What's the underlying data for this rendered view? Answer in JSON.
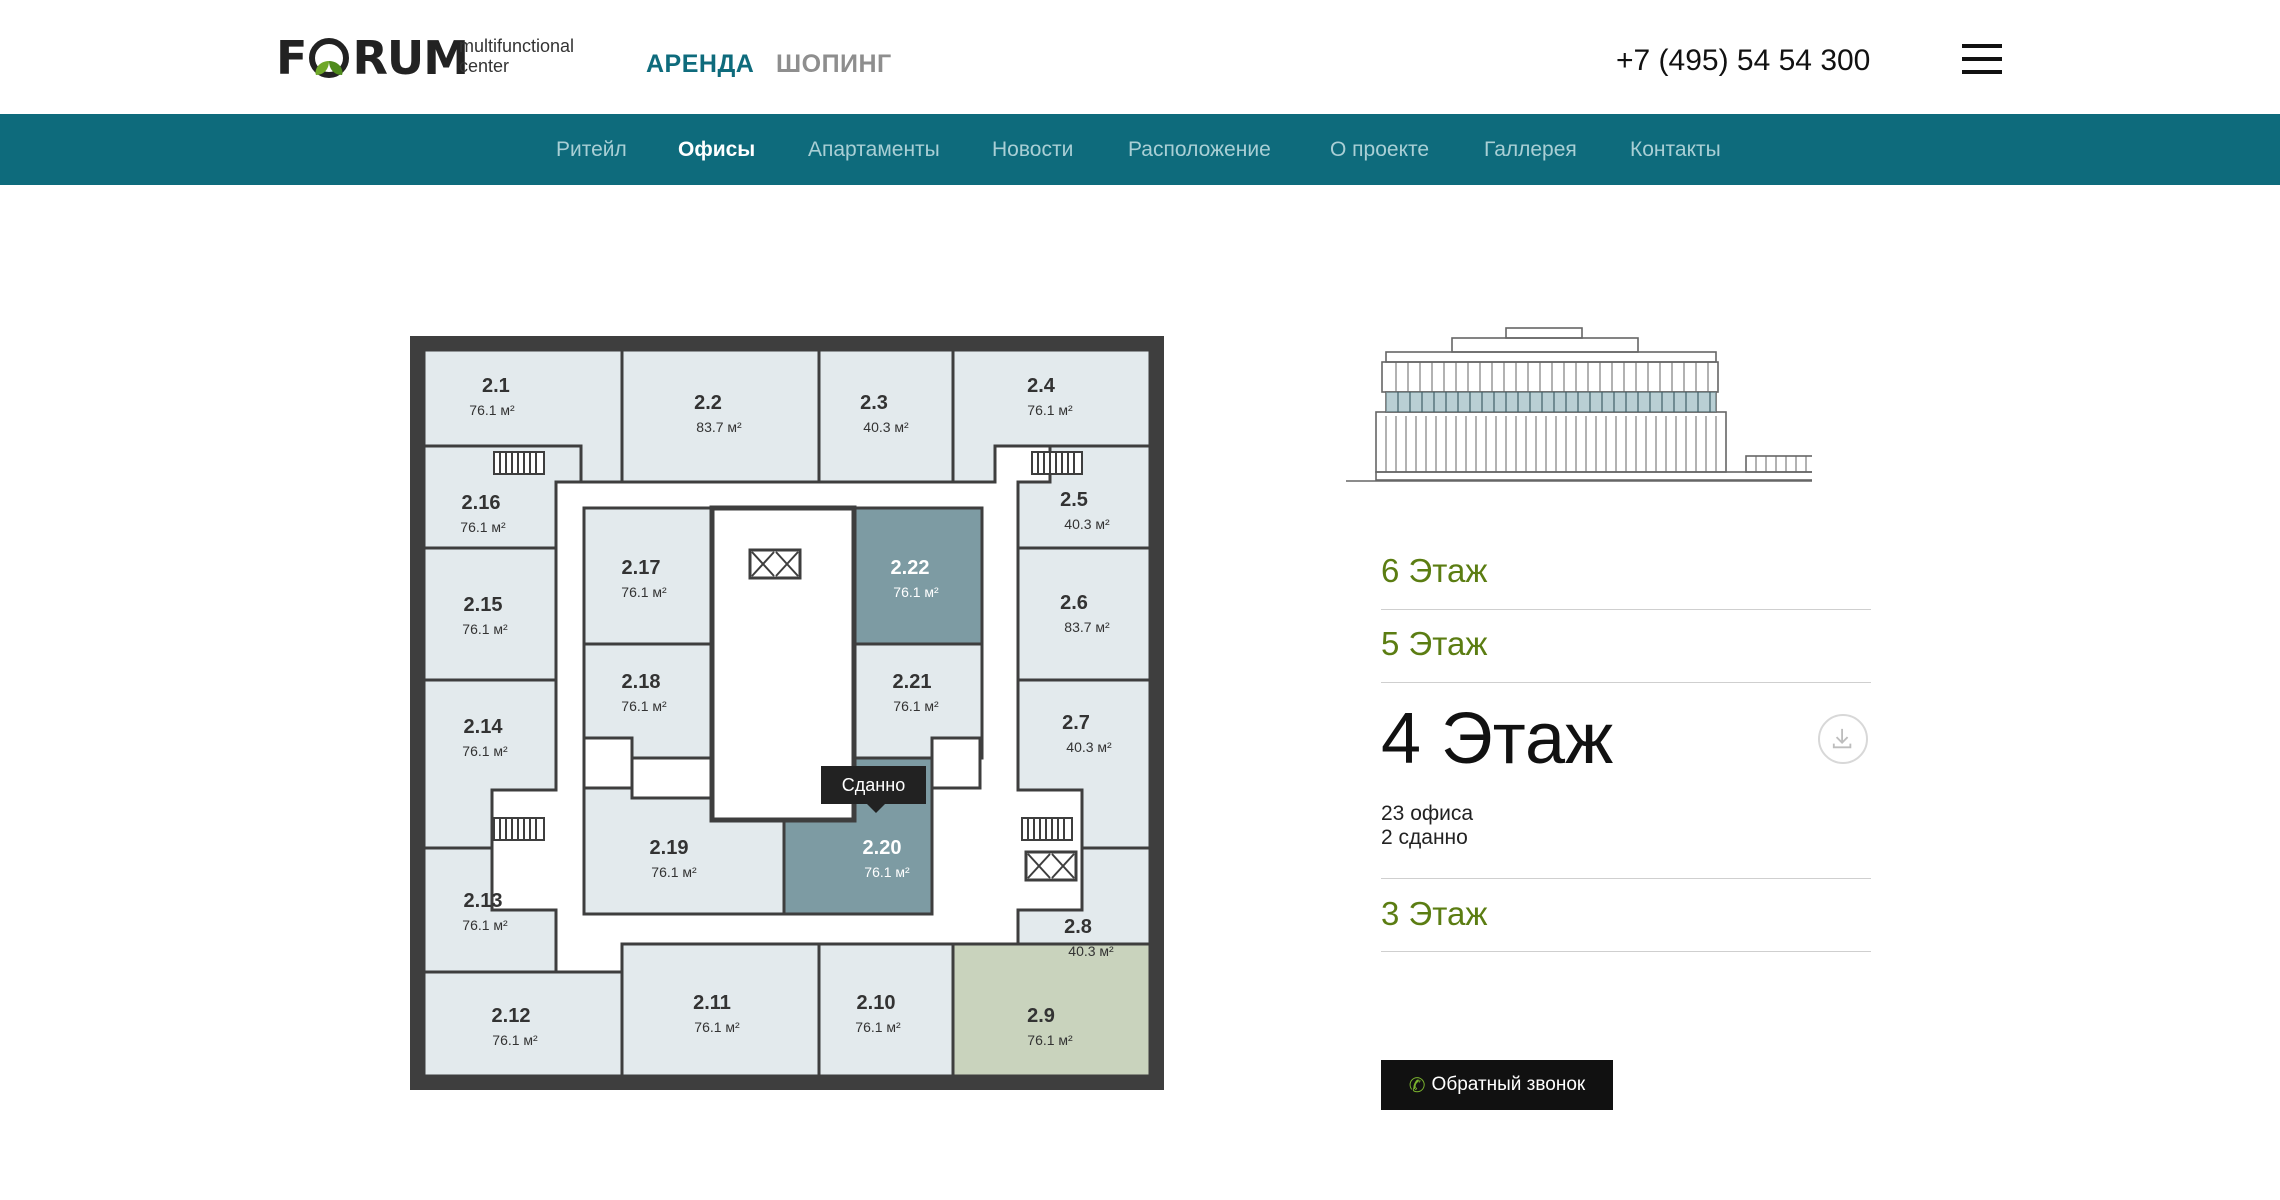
{
  "header": {
    "logo_text_left": "F",
    "logo_text_right": "RUM",
    "logo_sub_1": "multifunctional",
    "logo_sub_2": "center",
    "nav_rent": "АРЕНДА",
    "nav_shopping": "ШОПИНГ",
    "phone": "+7 (495) 54 54 300",
    "menu_icon": "hamburger-menu-icon"
  },
  "navbar": {
    "items": [
      "Ритейл",
      "Офисы",
      "Апартаменты",
      "Новости",
      "Расположение",
      "О проекте",
      "Галлерея",
      "Контакты"
    ],
    "active": "Офисы"
  },
  "colors": {
    "brand_teal": "#0e6b7c",
    "floor_link_green": "#5b7d12",
    "room_free": "#e3eaed",
    "room_rented": "#7d9ba3",
    "room_highlight": "#c9d3bd",
    "plan_frame": "#3e3e3e"
  },
  "plan": {
    "rooms": [
      {
        "id": "2.1",
        "area": "76.1 м²",
        "status": "free"
      },
      {
        "id": "2.2",
        "area": "83.7 м²",
        "status": "free"
      },
      {
        "id": "2.3",
        "area": "40.3 м²",
        "status": "free"
      },
      {
        "id": "2.4",
        "area": "76.1 м²",
        "status": "free"
      },
      {
        "id": "2.5",
        "area": "40.3 м²",
        "status": "free"
      },
      {
        "id": "2.6",
        "area": "83.7 м²",
        "status": "free"
      },
      {
        "id": "2.7",
        "area": "40.3 м²",
        "status": "free"
      },
      {
        "id": "2.8",
        "area": "40.3 м²",
        "status": "free"
      },
      {
        "id": "2.9",
        "area": "76.1 м²",
        "status": "highlight"
      },
      {
        "id": "2.10",
        "area": "76.1 м²",
        "status": "free"
      },
      {
        "id": "2.11",
        "area": "76.1 м²",
        "status": "free"
      },
      {
        "id": "2.12",
        "area": "76.1 м²",
        "status": "free"
      },
      {
        "id": "2.13",
        "area": "76.1 м²",
        "status": "free"
      },
      {
        "id": "2.14",
        "area": "76.1 м²",
        "status": "free"
      },
      {
        "id": "2.15",
        "area": "76.1 м²",
        "status": "free"
      },
      {
        "id": "2.16",
        "area": "76.1 м²",
        "status": "free"
      },
      {
        "id": "2.17",
        "area": "76.1 м²",
        "status": "free"
      },
      {
        "id": "2.18",
        "area": "76.1 м²",
        "status": "free"
      },
      {
        "id": "2.19",
        "area": "76.1 м²",
        "status": "free"
      },
      {
        "id": "2.20",
        "area": "76.1 м²",
        "status": "rented"
      },
      {
        "id": "2.21",
        "area": "76.1 м²",
        "status": "free"
      },
      {
        "id": "2.22",
        "area": "76.1 м²",
        "status": "rented"
      }
    ],
    "tooltip": "Сданно"
  },
  "floors": {
    "floor_6": "6 Этаж",
    "floor_5": "5 Этаж",
    "current": "4 Этаж",
    "offices": "23 офиса",
    "rented": "2 сданно",
    "floor_3": "3 Этаж",
    "download_icon": "download-icon"
  },
  "callback": {
    "icon": "phone-icon",
    "label": "Обратный звонок"
  }
}
